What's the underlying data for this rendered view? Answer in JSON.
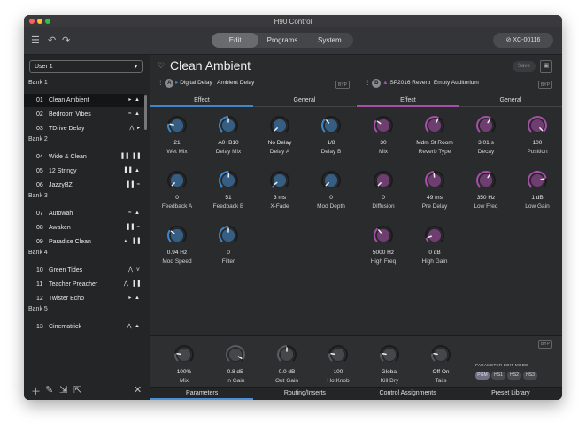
{
  "window": {
    "title": "H90 Control"
  },
  "toolbar": {
    "tabs": [
      "Edit",
      "Programs",
      "System"
    ],
    "device": "XC-00116"
  },
  "sidebar": {
    "select": "User 1",
    "banks": [
      {
        "name": "Bank 1",
        "presets": [
          {
            "num": "01",
            "name": "Clean Ambient",
            "icons": "▸ ▲"
          },
          {
            "num": "02",
            "name": "Bedroom Vibes",
            "icons": "≈ ▲"
          },
          {
            "num": "03",
            "name": "TDrive Delay",
            "icons": "⋀ ▸"
          }
        ]
      },
      {
        "name": "Bank 2",
        "presets": [
          {
            "num": "04",
            "name": "Wide & Clean",
            "icons": "▐▐ ▐▐"
          },
          {
            "num": "05",
            "name": "12 Stringy",
            "icons": "▐▐ ▲"
          },
          {
            "num": "06",
            "name": "JazzyBZ",
            "icons": "▐▐ ≈"
          }
        ]
      },
      {
        "name": "Bank 3",
        "presets": [
          {
            "num": "07",
            "name": "Autowah",
            "icons": "≈ ▲"
          },
          {
            "num": "08",
            "name": "Awaken",
            "icons": "▐▐ ≈"
          },
          {
            "num": "09",
            "name": "Paradise Clean",
            "icons": "▲ ▐▐"
          }
        ]
      },
      {
        "name": "Bank 4",
        "presets": [
          {
            "num": "10",
            "name": "Green Tides",
            "icons": "⋀ ⋎"
          },
          {
            "num": "11",
            "name": "Teacher Preacher",
            "icons": "⋀ ▐▐"
          },
          {
            "num": "12",
            "name": "Twister Echo",
            "icons": "▸ ▲"
          }
        ]
      },
      {
        "name": "Bank 5",
        "presets": [
          {
            "num": "13",
            "name": "Cinematrick",
            "icons": "⋀ ▲"
          }
        ]
      }
    ]
  },
  "main": {
    "title": "Clean Ambient",
    "save": "Save",
    "slotA": {
      "badge": "A",
      "algo": "Digital Delay",
      "preset": "Ambient Delay",
      "byp": "BYP"
    },
    "slotB": {
      "badge": "B",
      "algo": "SP2016 Reverb",
      "preset": "Empty Auditorium",
      "byp": "BYP"
    },
    "tabsA": [
      "Effect",
      "General"
    ],
    "tabsB": [
      "Effect",
      "General"
    ],
    "knobsA": [
      {
        "value": "21",
        "label": "Wet Mix",
        "level": 0.21
      },
      {
        "value": "A0+B10",
        "label": "Delay Mix",
        "level": 0.5
      },
      {
        "value": "No Delay",
        "label": "Delay A",
        "level": 0.0
      },
      {
        "value": "1/8",
        "label": "Delay B",
        "level": 0.35
      },
      {
        "value": "0",
        "label": "Feedback A",
        "level": 0.0
      },
      {
        "value": "51",
        "label": "Feedback B",
        "level": 0.51
      },
      {
        "value": "3 ms",
        "label": "X-Fade",
        "level": 0.03
      },
      {
        "value": "0",
        "label": "Mod Depth",
        "level": 0.0
      },
      {
        "value": "0.94 Hz",
        "label": "Mod Speed",
        "level": 0.3
      },
      {
        "value": "0",
        "label": "Filter",
        "level": 0.5
      }
    ],
    "knobsB": [
      {
        "value": "30",
        "label": "Mix",
        "level": 0.3
      },
      {
        "value": "Mdm St Room",
        "label": "Reverb Type",
        "level": 0.6
      },
      {
        "value": "3.01 s",
        "label": "Decay",
        "level": 0.62
      },
      {
        "value": "100",
        "label": "Position",
        "level": 1.0
      },
      {
        "value": "0",
        "label": "Diffusion",
        "level": 0.0
      },
      {
        "value": "49 ms",
        "label": "Pre Delay",
        "level": 0.48
      },
      {
        "value": "350 Hz",
        "label": "Low Freq",
        "level": 0.62
      },
      {
        "value": "1 dB",
        "label": "Low Gain",
        "level": 0.78
      },
      {
        "value": "5000 Hz",
        "label": "High Freq",
        "level": 0.35
      },
      {
        "value": "0 dB",
        "label": "High Gain",
        "level": 0.1
      }
    ],
    "global": {
      "byp": "BYP",
      "knobs": [
        {
          "value": "100%",
          "label": "Mix",
          "level": 0.2
        },
        {
          "value": "0.8 dB",
          "label": "In Gain",
          "level": 0.95
        },
        {
          "value": "0.0 dB",
          "label": "Out Gain",
          "level": 0.5
        },
        {
          "value": "100",
          "label": "HotKnob",
          "level": 0.2
        },
        {
          "value": "Global",
          "label": "Kill Dry",
          "level": 0.2
        },
        {
          "value": "Off On",
          "label": "Tails",
          "level": 0.2
        }
      ],
      "pem_label": "PARAMETER EDIT MODE",
      "pem_options": [
        "PGM",
        "HS1",
        "HS2",
        "HS3"
      ]
    },
    "footer_tabs": [
      "Parameters",
      "Routing/Inserts",
      "Control Assignments",
      "Preset Library"
    ]
  },
  "colors": {
    "slotA": "#3f86c9",
    "slotB": "#a64fa8",
    "accent": "#4a90d9"
  }
}
